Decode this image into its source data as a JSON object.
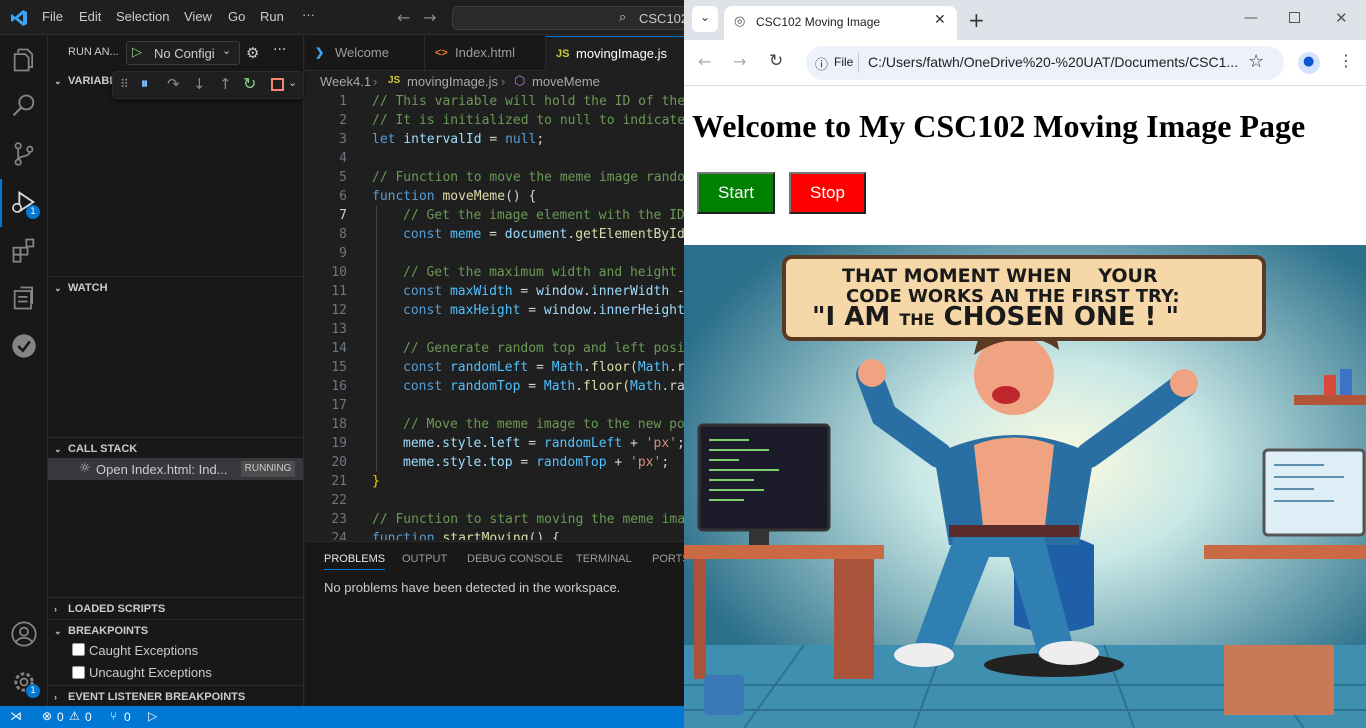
{
  "vscode": {
    "menu": [
      "File",
      "Edit",
      "Selection",
      "View",
      "Go",
      "Run",
      "···"
    ],
    "command_center": "CSC102",
    "sidebar": {
      "run_label": "RUN AN...",
      "config": "No Configi",
      "variables": "VARIABL",
      "watch": "WATCH",
      "call_stack": "CALL STACK",
      "call_item": "Open Index.html: Ind...",
      "call_status": "RUNNING",
      "loaded_scripts": "LOADED SCRIPTS",
      "breakpoints": "BREAKPOINTS",
      "bp_caught": "Caught Exceptions",
      "bp_uncaught": "Uncaught Exceptions",
      "event_bp": "EVENT LISTENER BREAKPOINTS"
    },
    "activity_badges": {
      "debug": "1",
      "accounts": "1"
    },
    "tabs": [
      {
        "label": "Welcome",
        "icon": "vscode-icon"
      },
      {
        "label": "Index.html",
        "icon": "html-icon"
      },
      {
        "label": "movingImage.js",
        "icon": "js-icon"
      }
    ],
    "breadcrumb": {
      "folder": "Week4.1",
      "file": "movingImage.js",
      "symbol": "moveMeme"
    },
    "line_numbers": [
      "1",
      "2",
      "3",
      "4",
      "5",
      "6",
      "7",
      "8",
      "9",
      "10",
      "11",
      "12",
      "13",
      "14",
      "15",
      "16",
      "17",
      "18",
      "19",
      "20",
      "21",
      "22",
      "23",
      "24"
    ],
    "code": {
      "l1": "// This variable will hold the ID of the",
      "l2": "// It is initialized to null to indicate",
      "l3a": "let",
      "l3b": "intervalId",
      "l3c": " = ",
      "l3d": "null",
      "l3e": ";",
      "l5": "// Function to move the meme image random",
      "l6a": "function",
      "l6b": "moveMeme",
      "l6c": "() {",
      "l7": "// Get the image element with the ID",
      "l8a": "const",
      "l8b": "meme",
      "l8c": " = ",
      "l8d": "document",
      "l8e": ".",
      "l8f": "getElementById",
      "l10": "// Get the maximum width and height t",
      "l11a": "const",
      "l11b": "maxWidth",
      "l11c": " = ",
      "l11d": "window",
      "l11e": ".",
      "l11f": "innerWidth",
      "l11g": " -",
      "l12a": "const",
      "l12b": "maxHeight",
      "l12c": " = ",
      "l12d": "window",
      "l12e": ".",
      "l12f": "innerHeight",
      "l14": "// Generate random top and left posit",
      "l15a": "const",
      "l15b": "randomLeft",
      "l15c": " = ",
      "l15d": "Math",
      "l15e": ".",
      "l15f": "floor",
      "l15g": "(",
      "l15h": "Math",
      "l15i": ".ra",
      "l16a": "const",
      "l16b": "randomTop",
      "l16c": " = ",
      "l16d": "Math",
      "l16e": ".",
      "l16f": "floor",
      "l16g": "(",
      "l16h": "Math",
      "l16i": ".ran",
      "l18": "// Move the meme image to the new pos",
      "l19a": "meme",
      "l19b": ".",
      "l19c": "style",
      "l19d": ".",
      "l19e": "left",
      "l19f": " = ",
      "l19g": "randomLeft",
      "l19h": " + ",
      "l19i": "'px'",
      "l19j": ";",
      "l20a": "meme",
      "l20b": ".",
      "l20c": "style",
      "l20d": ".",
      "l20e": "top",
      "l20f": " = ",
      "l20g": "randomTop",
      "l20h": " + ",
      "l20i": "'px'",
      "l20j": ";",
      "l21": "}",
      "l23": "// Function to start moving the meme imag",
      "l24a": "function",
      "l24b": "startMoving",
      "l24c": "() {"
    },
    "panel": {
      "tabs": [
        "PROBLEMS",
        "OUTPUT",
        "DEBUG CONSOLE",
        "TERMINAL",
        "PORTS"
      ],
      "message": "No problems have been detected in the workspace."
    },
    "status": {
      "errors": "0",
      "warnings": "0",
      "ports": "0"
    }
  },
  "browser": {
    "tab_title": "CSC102 Moving Image",
    "url_prefix": "File",
    "url": "C:/Users/fatwh/OneDrive%20-%20UAT/Documents/CSC1...",
    "page": {
      "heading": "Welcome to My CSC102 Moving Image Page",
      "start_label": "Start",
      "stop_label": "Stop",
      "start_color": "#008000",
      "stop_color": "#ff0000"
    },
    "meme": {
      "line1": "THAT MOMENT WHEN    YOUR",
      "line2": "CODE WORKS AN THE FIRST TRY:",
      "line3a": "\"I AM ",
      "line3b": "THE",
      "line3c": " CHOSEN ONE ! \""
    }
  },
  "colors": {
    "accent": "#0078d4",
    "editor_bg": "#1f1f1f",
    "sidebar_bg": "#181818"
  }
}
